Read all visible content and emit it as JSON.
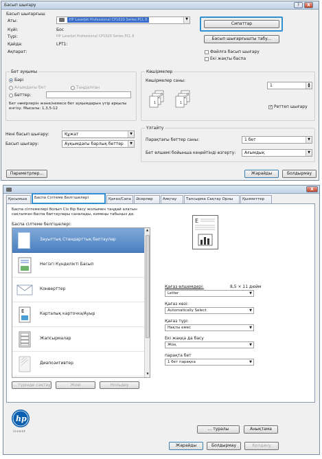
{
  "print_dialog": {
    "title": "Басып шығару",
    "title_buttons": [
      "?",
      "X"
    ],
    "printer_group": "Басып шығарғыш",
    "name_label": "Аты:",
    "name_value": "HP LaserJet Professional CP1020 Series PCL 6",
    "status_label": "Күйі:",
    "status_value": "Бос",
    "type_label": "Түрі:",
    "type_value": "HP LaserJet Professional CP1020 Series PCL 6",
    "where_label": "Қайда:",
    "where_value": "LPT1:",
    "comment_label": "Ақпарат:",
    "properties_button": "Сипаттар",
    "find_printer_button": "Басып шығарғышты табу...",
    "print_to_file_label": "Файлға басып шығару",
    "manual_duplex_label": "Екі жақты баспа",
    "page_range_group": "Бет ауқымы",
    "all_label": "Бәрі",
    "current_page_label": "Ағымдағы бет",
    "selection_label": "Таңдалған",
    "pages_label": "Беттер:",
    "pages_hint": "Бет нөмірлерін және/немесе бет ауқымдарын үтір арқылы енгізу. Мысалы: 1,3,5-12",
    "copies_group": "Көшірмелер",
    "copies_label": "Көшірмелер саны:",
    "copies_value": "1",
    "collate_label": "Реттеп шығару",
    "print_what_label": "Нені басып шығару:",
    "print_what_value": "Құжат",
    "print_label": "Басып шығару:",
    "print_value": "Ауқымдағы барлық беттер",
    "zoom_group": "Үлгайту",
    "pages_per_sheet_label": "Парақтағы беттер саны:",
    "pages_per_sheet_value": "1 бет",
    "scale_label": "Бет өлшемі бойынша кеңейтінді өзгерту:",
    "scale_value": "Ағымдық",
    "options_button": "Параметрлер...",
    "ok_button": "Жарайды",
    "cancel_button": "Болдырмау"
  },
  "properties_dialog": {
    "title_buttons": [
      "X"
    ],
    "tabs": [
      "Қосымша",
      "Баспа Сілтеме Белгішелері",
      "Қағаз/Сапа",
      "Әсерлер",
      "Аяқтау",
      "Тапсырма Сақтау Орны",
      "Қызметтер"
    ],
    "description": "Баспа сілтемелері болып Сіз бір басу жолымен таңдай алатын сақталған баспа баптаулары саналады, кимеңы табыңыз да.",
    "shortcuts_label": "Баспа сілтеме белгішелері:",
    "shortcuts": [
      "Зауыттық Стандарттық баптаулар",
      "Негізгі Күнделікті Басып",
      "Конверттер",
      "Карталық карточка/Ауыр",
      "Жапсырмалар",
      "Диапозитивтер"
    ],
    "save_as_button": "... түрінде сақтау",
    "save_button": "Жою",
    "reset_button": "Нольдеу",
    "paper_size_label": "Қағаз өлшемдері:",
    "paper_size_dims": "8,5 × 11 дюйм",
    "paper_size_value": "Letter",
    "paper_source_label": "Қағаз көзі:",
    "paper_source_value": "Automatically Select",
    "paper_type_label": "Қағаз түрі:",
    "paper_type_value": "Нақты емес",
    "duplex_label": "Екі жаққа да басу",
    "duplex_value": "Жоқ",
    "pages_per_sheet_label": "парақта бет",
    "pages_per_sheet_value": "1 бет парақка",
    "about_button": "... туралы",
    "help_button": "Анықтама",
    "ok_button": "Жарайды",
    "cancel_button": "Болдырмау",
    "apply_button": "Қолдану",
    "brand_text": "invent"
  }
}
